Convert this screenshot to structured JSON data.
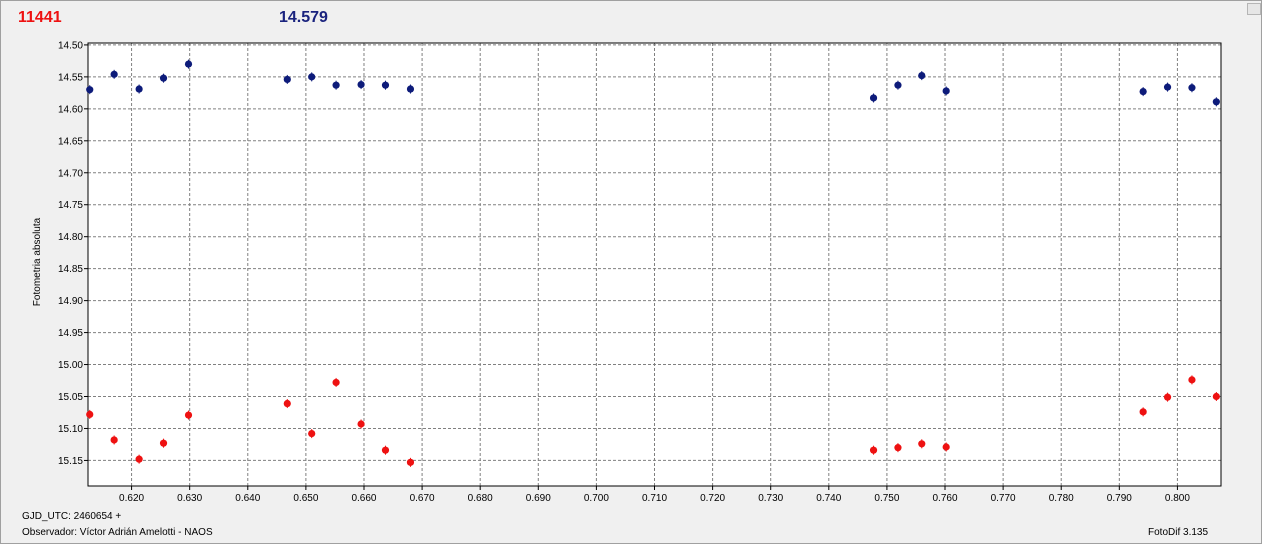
{
  "header": {
    "left_value": "11441",
    "left_color": "#ee1111",
    "right_value": "14.579",
    "right_color": "#1a237e"
  },
  "footer": {
    "date_line": "GJD_UTC: 2460654 +",
    "observer_line": "Observador: Víctor Adrián Amelotti - NAOS",
    "version": "FotoDif 3.135"
  },
  "chart_data": {
    "type": "scatter",
    "ylabel": "Fotometria absoluta",
    "xlabel": "",
    "xlim": [
      0.6125,
      0.8075
    ],
    "ylim": [
      15.19,
      14.497
    ],
    "y_inverted": true,
    "x_ticks": [
      "0.620",
      "0.630",
      "0.640",
      "0.650",
      "0.660",
      "0.670",
      "0.680",
      "0.690",
      "0.700",
      "0.710",
      "0.720",
      "0.730",
      "0.740",
      "0.750",
      "0.760",
      "0.770",
      "0.780",
      "0.790",
      "0.800"
    ],
    "y_ticks": [
      "14.50",
      "14.55",
      "14.60",
      "14.65",
      "14.70",
      "14.75",
      "14.80",
      "14.85",
      "14.90",
      "14.95",
      "15.00",
      "15.05",
      "15.10",
      "15.15"
    ],
    "grid": true,
    "background": "#ffffff",
    "series": [
      {
        "color": "#0d1b7a",
        "points": [
          [
            0.6128,
            14.57
          ],
          [
            0.617,
            14.546
          ],
          [
            0.6213,
            14.569
          ],
          [
            0.6255,
            14.552
          ],
          [
            0.6298,
            14.53
          ],
          [
            0.6468,
            14.554
          ],
          [
            0.651,
            14.55
          ],
          [
            0.6552,
            14.563
          ],
          [
            0.6595,
            14.562
          ],
          [
            0.6637,
            14.563
          ],
          [
            0.668,
            14.569
          ],
          [
            0.7477,
            14.583
          ],
          [
            0.7519,
            14.563
          ],
          [
            0.756,
            14.548
          ],
          [
            0.7602,
            14.572
          ],
          [
            0.7941,
            14.573
          ],
          [
            0.7983,
            14.566
          ],
          [
            0.8025,
            14.567
          ],
          [
            0.8067,
            14.589
          ]
        ]
      },
      {
        "color": "#ee1111",
        "points": [
          [
            0.6128,
            15.078
          ],
          [
            0.617,
            15.118
          ],
          [
            0.6213,
            15.148
          ],
          [
            0.6255,
            15.123
          ],
          [
            0.6298,
            15.079
          ],
          [
            0.6468,
            15.061
          ],
          [
            0.651,
            15.108
          ],
          [
            0.6552,
            15.028
          ],
          [
            0.6595,
            15.093
          ],
          [
            0.6637,
            15.134
          ],
          [
            0.668,
            15.153
          ],
          [
            0.7477,
            15.134
          ],
          [
            0.7519,
            15.13
          ],
          [
            0.756,
            15.124
          ],
          [
            0.7602,
            15.129
          ],
          [
            0.7941,
            15.074
          ],
          [
            0.7983,
            15.051
          ],
          [
            0.8025,
            15.024
          ],
          [
            0.8067,
            15.05
          ]
        ]
      }
    ]
  }
}
